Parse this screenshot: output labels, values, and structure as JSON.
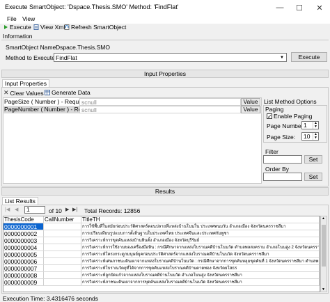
{
  "window": {
    "title": "Execute SmartObject: 'Dspace.Thesis.SMO' Method: 'FindFlat'",
    "minimize": "—",
    "maximize": "☐",
    "close": "✕"
  },
  "menu": {
    "file": "File",
    "view": "View"
  },
  "toolbar": {
    "execute": "Execute",
    "view_xml": "View Xml",
    "refresh": "Refresh SmartObject"
  },
  "information": {
    "section_label": "Information",
    "smartobject_label": "SmartObject Name:",
    "smartobject_value": "Dspace.Thesis.SMO",
    "method_label": "Method to Execute:",
    "method_value": "FindFlat",
    "execute_button": "Execute"
  },
  "input_properties": {
    "header": "Input Properties",
    "tab": "Input Properties",
    "clear_values": "Clear Values",
    "generate_data": "Generate Data",
    "rows": [
      {
        "label": "PageSize ( Number ) - Required",
        "value": "scnull",
        "button": "Value"
      },
      {
        "label": "PageNumber ( Number ) - Required",
        "value": "scnull",
        "button": "Value"
      }
    ]
  },
  "list_method_options": {
    "title": "List Method Options",
    "paging": "Paging",
    "enable_paging": "Enable Paging",
    "page_number_label": "Page Number:",
    "page_number_value": "1",
    "page_size_label": "Page Size:",
    "page_size_value": "10",
    "filter": "Filter",
    "filter_set": "Set",
    "order_by": "Order By",
    "order_set": "Set"
  },
  "results": {
    "header": "Results",
    "tab": "List Results",
    "page_value": "1",
    "of_pages": "of 10",
    "total_records": "Total Records: 12856",
    "columns": [
      "ThesisCode",
      "CallNumber",
      "TitleTH"
    ],
    "rows": [
      {
        "code": "0000000001",
        "call": "",
        "title": "การใช้พื้นที่ในสมัยก่อนประวัติศาสตร์ตอนปลายที่แหล่งบ้านโนนใน ประเทศพนมวัน อำเภอเมือง จังหวัดนครราชสีมา"
      },
      {
        "code": "0000000002",
        "call": "",
        "title": "การเปรียบเทียบรูปแบบการตั้งถิ่นฐานในประเทศไทย ประเทศจีนและประเทศกัมพูชา"
      },
      {
        "code": "0000000003",
        "call": "",
        "title": "การวิเคราะห์การขุดค้นแหล่งบ้านหินตั้ง อำเภอเมือง จังหวัดบุรีรัมย์"
      },
      {
        "code": "0000000004",
        "call": "",
        "title": "การวิเคราะห์การใช้งานของเครื่องมือหิน : กรณีศึกษาจากแหล่งโบราณคดีบ้านโนนวัด ตำบลพลสงคราม อำเภอโนนสูง 2 จังหวัดนครราชสีมา"
      },
      {
        "code": "0000000005",
        "call": "",
        "title": "การวิเคราะห์โครงกระดูกมนุษย์ยุคก่อนประวัติศาสตร์จากแหล่งโบราณคดีบ้านโนนวัด จังหวัดนครราชสีมา"
      },
      {
        "code": "0000000006",
        "call": "",
        "title": "การวิเคราะห์เศษภาชนะดินเผาจากแหล่งโบราณคดีบ้านโนนวัด : กรณีศึกษาจากการขุดค้นหลุมขุดค้นที่ 1 จังหวัดนครราชสีมา ตำบลพลสงคราม อำเภอเมือง จังหวัดนครราชสีมา"
      },
      {
        "code": "0000000007",
        "call": "",
        "title": "การวิเคราะห์โบราณวัตถุที่ได้จากการขุดค้นแหล่งโบราณคดีบ้านตาดทอง จังหวัดยโสธร"
      },
      {
        "code": "0000000008",
        "call": "",
        "title": "การวิเคราะห์ลูกปัดแก้วจากแหล่งโบราณคดีบ้านโนนวัด อำเภอโนนสูง จังหวัดนครราชสีมา"
      },
      {
        "code": "0000000009",
        "call": "",
        "title": "การวิเคราะห์ภาชนะดินเผาจากการขุดค้นแหล่งโบราณคดีบ้านโนนวัด จังหวัดนครราชสีมา"
      }
    ]
  },
  "status": {
    "execution_time": "Execution Time: 3.4316476 seconds"
  }
}
